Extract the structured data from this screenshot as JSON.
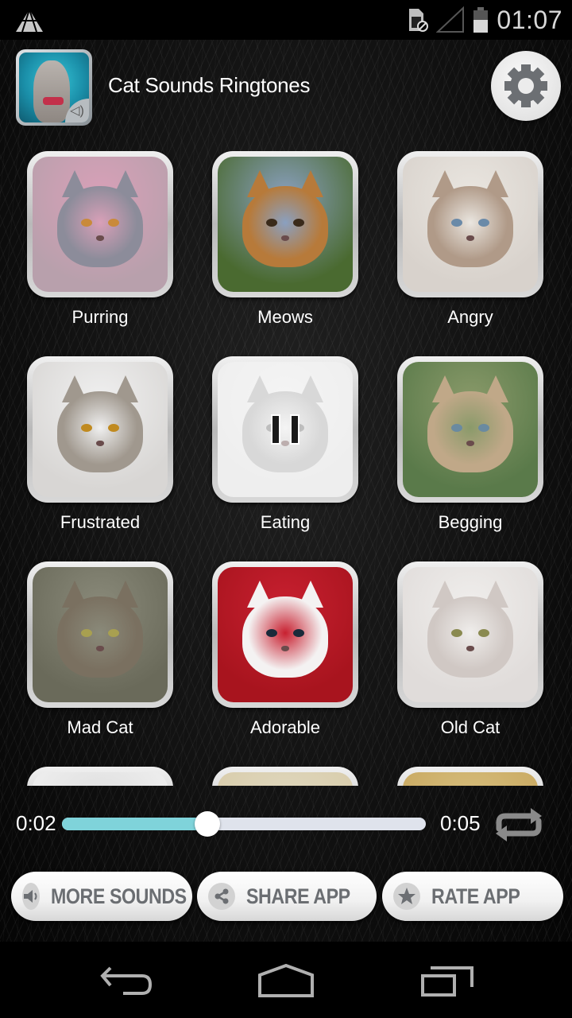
{
  "status_bar": {
    "time": "01:07",
    "icons": [
      "launcher-triangle-icon",
      "sim-card-missing-icon",
      "signal-empty-icon",
      "battery-half-icon"
    ]
  },
  "header": {
    "title": "Cat Sounds Ringtones",
    "app_icon": "cat-speaker-icon",
    "settings_icon": "gear-icon"
  },
  "sounds": [
    {
      "label": "Purring",
      "state": "idle",
      "colors": {
        "bg": "#b8a0ac",
        "fur": "#8c8c9a",
        "eye": "#c98a3a",
        "accent": "#d9a0b8"
      }
    },
    {
      "label": "Meows",
      "state": "idle",
      "colors": {
        "bg": "#4a6a30",
        "fur": "#b77a3a",
        "eye": "#3a2a1a",
        "accent": "#8aa0c0"
      }
    },
    {
      "label": "Angry",
      "state": "idle",
      "colors": {
        "bg": "#d8d2cc",
        "fur": "#b09a88",
        "eye": "#6a8aa8",
        "accent": "#eae6e0"
      }
    },
    {
      "label": "Frustrated",
      "state": "idle",
      "colors": {
        "bg": "#d8d6d4",
        "fur": "#a0988e",
        "eye": "#c08a20",
        "accent": "#f0f0f0"
      }
    },
    {
      "label": "Eating",
      "state": "playing",
      "colors": {
        "bg": "#d9d9d9",
        "fur": "#a8a8a8",
        "eye": "#707070",
        "accent": "#e8e8e8"
      }
    },
    {
      "label": "Begging",
      "state": "idle",
      "colors": {
        "bg": "#5a7a4a",
        "fur": "#c0a888",
        "eye": "#6a8aa0",
        "accent": "#8a9a6a"
      }
    },
    {
      "label": "Mad Cat",
      "state": "idle",
      "colors": {
        "bg": "#6a6a5a",
        "fur": "#7a7060",
        "eye": "#a8a050",
        "accent": "#8a8a7a"
      }
    },
    {
      "label": "Adorable",
      "state": "idle",
      "colors": {
        "bg": "#a8141e",
        "fur": "#f4f2f2",
        "eye": "#1a2a3a",
        "accent": "#c82030"
      }
    },
    {
      "label": "Old Cat",
      "state": "idle",
      "colors": {
        "bg": "#e0dcda",
        "fur": "#d0c8c4",
        "eye": "#8a8a50",
        "accent": "#f0eeec"
      }
    },
    {
      "label": "",
      "state": "idle",
      "colors": {
        "bg": "#f0f0f0",
        "fur": "#a08870",
        "eye": "#444",
        "accent": "#ddd"
      }
    },
    {
      "label": "",
      "state": "idle",
      "colors": {
        "bg": "#d8ccaa",
        "fur": "#c8b890",
        "eye": "#444",
        "accent": "#e0d8c0"
      }
    },
    {
      "label": "",
      "state": "idle",
      "colors": {
        "bg": "#c8a860",
        "fur": "#b89850",
        "eye": "#444",
        "accent": "#d8c080"
      }
    }
  ],
  "player": {
    "current_time": "0:02",
    "total_time": "0:05",
    "progress_fraction": 0.4,
    "repeat_icon": "repeat-icon",
    "colors": {
      "fill": "#7fd3da",
      "track": "#dfe3ec"
    }
  },
  "actions": {
    "more_sounds": "MORE SOUNDS",
    "share_app": "SHARE APP",
    "rate_app": "RATE APP"
  },
  "nav_bar": {
    "back": "back-icon",
    "home": "home-icon",
    "recents": "recents-icon"
  }
}
